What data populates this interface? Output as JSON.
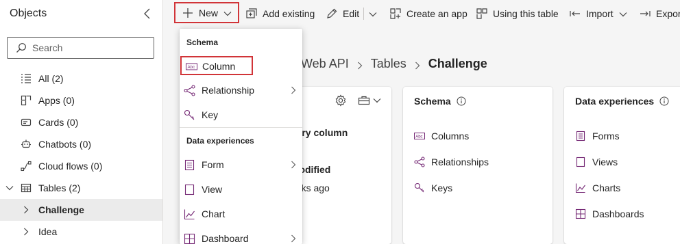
{
  "sidebar": {
    "title": "Objects",
    "search_placeholder": "Search",
    "items": [
      {
        "label": "All (2)",
        "icon": "list-icon"
      },
      {
        "label": "Apps (0)",
        "icon": "apps-icon"
      },
      {
        "label": "Cards (0)",
        "icon": "card-icon"
      },
      {
        "label": "Chatbots (0)",
        "icon": "bot-icon"
      },
      {
        "label": "Cloud flows (0)",
        "icon": "flow-icon"
      },
      {
        "label": "Tables (2)",
        "icon": "table-icon"
      },
      {
        "label": "Challenge",
        "icon": "chevron-right-icon"
      },
      {
        "label": "Idea",
        "icon": "chevron-right-icon"
      }
    ]
  },
  "toolbar": {
    "new_label": "New",
    "add_existing_label": "Add existing",
    "edit_label": "Edit",
    "create_app_label": "Create an app",
    "using_table_label": "Using this table",
    "import_label": "Import",
    "export_label": "Expor"
  },
  "breadcrumb": {
    "items": [
      "e Web API",
      "Tables",
      "Challenge"
    ]
  },
  "menu": {
    "schema_header": "Schema",
    "column_label": "Column",
    "relationship_label": "Relationship",
    "key_label": "Key",
    "data_exp_header": "Data experiences",
    "form_label": "Form",
    "view_label": "View",
    "chart_label": "Chart",
    "dashboard_label": "Dashboard"
  },
  "table_card": {
    "primary_column_label": "nary column",
    "primary_column_value": "ne",
    "last_modified_label": "modified",
    "last_modified_value": "eeks ago"
  },
  "schema_card": {
    "title": "Schema",
    "items": [
      "Columns",
      "Relationships",
      "Keys"
    ]
  },
  "data_exp_card": {
    "title": "Data experiences",
    "items": [
      "Forms",
      "Views",
      "Charts",
      "Dashboards"
    ]
  },
  "colors": {
    "accent": "#742774",
    "highlight_border": "#d13438",
    "selected_bg": "#ebebeb"
  }
}
